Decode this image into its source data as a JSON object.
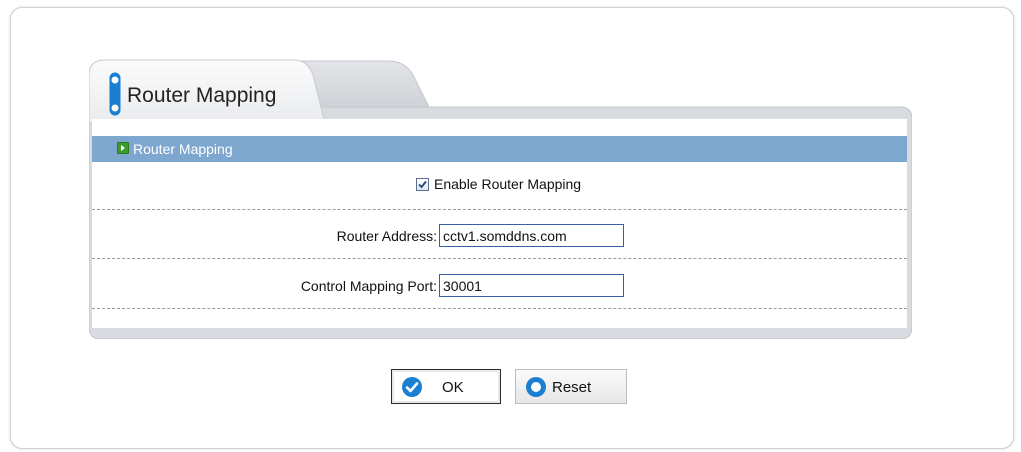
{
  "tab": {
    "title": "Router Mapping"
  },
  "section": {
    "header": "Router Mapping"
  },
  "form": {
    "enable_label": "Enable  Router Mapping",
    "enable_checked": true,
    "router_address_label": "Router Address:",
    "router_address_value": "cctv1.somddns.com",
    "control_port_label": "Control Mapping Port:",
    "control_port_value": "30001"
  },
  "buttons": {
    "ok_label": "OK",
    "reset_label": "Reset"
  },
  "icons": {
    "tab": "pill-marker-icon",
    "section": "arrow-right-icon",
    "ok": "check-circle-icon",
    "reset": "circle-icon"
  },
  "colors": {
    "header_bg": "#7ea7cf",
    "panel_bg": "#d9dce0",
    "accent_blue": "#1a7fd0",
    "input_border": "#3a5ea8"
  }
}
